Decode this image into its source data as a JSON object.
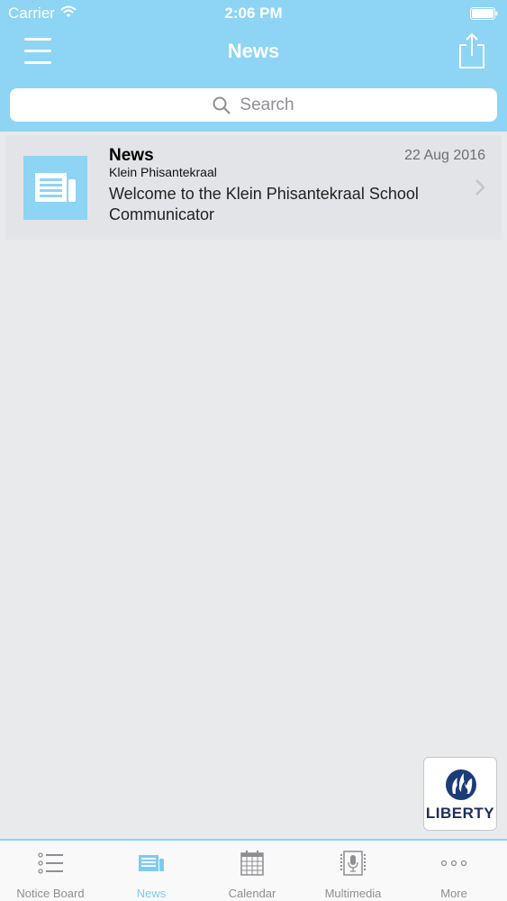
{
  "status_bar": {
    "carrier": "Carrier",
    "time": "2:06 PM"
  },
  "nav": {
    "title": "News"
  },
  "search": {
    "placeholder": "Search"
  },
  "news_items": [
    {
      "title": "News",
      "source": "Klein Phisantekraal",
      "message": "Welcome to the Klein Phisantekraal School Communicator",
      "date": "22 Aug 2016",
      "thumbnail_icon": "newspaper-icon"
    }
  ],
  "sponsor": {
    "name": "LIBERTY"
  },
  "tabs": [
    {
      "label": "Notice Board",
      "icon": "list-icon",
      "active": false
    },
    {
      "label": "News",
      "icon": "newspaper-icon",
      "active": true
    },
    {
      "label": "Calendar",
      "icon": "calendar-icon",
      "active": false
    },
    {
      "label": "Multimedia",
      "icon": "microphone-icon",
      "active": false
    },
    {
      "label": "More",
      "icon": "more-dots-icon",
      "active": false
    }
  ],
  "colors": {
    "accent": "#8dd4f5",
    "active_tab": "#7ccbf0",
    "background": "#e9eaec",
    "inactive_tab": "#8e8e93"
  }
}
